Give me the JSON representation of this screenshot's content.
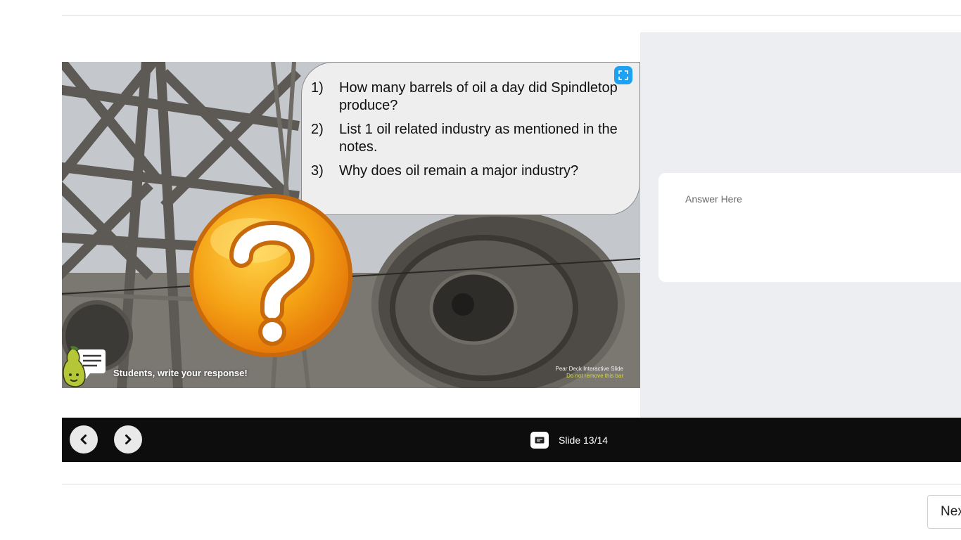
{
  "slide": {
    "questions": [
      {
        "num": "1)",
        "text": "How many barrels of oil a day did Spindletop produce?"
      },
      {
        "num": "2)",
        "text": "List 1 oil related industry as mentioned in the notes."
      },
      {
        "num": "3)",
        "text": "Why does oil remain a major industry?"
      }
    ],
    "response_prompt": "Students, write your response!",
    "note_line1": "Pear Deck Interactive Slide",
    "note_line2": "Do not remove this bar"
  },
  "answer": {
    "placeholder": "Answer Here",
    "value": ""
  },
  "navbar": {
    "slide_label": "Slide 13/14"
  },
  "footer": {
    "next_label": "Next"
  },
  "colors": {
    "navbar_bg": "#0d0d0d",
    "panel_bg": "#eceef1",
    "expand_button": "#1da1f2",
    "badge_orange": "#f29a0e"
  },
  "icons": [
    "fullscreen-icon",
    "question-mark-icon",
    "pear-deck-logo",
    "chevron-left-icon",
    "chevron-right-icon",
    "slide-icon"
  ]
}
